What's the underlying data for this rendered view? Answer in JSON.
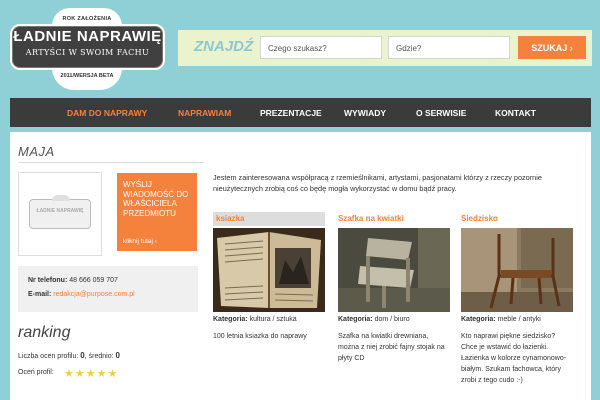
{
  "logo": {
    "top": "ROK ZAŁOŻENIA",
    "title": "ŁADNIE NAPRAWIĘ",
    "subtitle": "ARTYŚCI W SWOIM FACHU",
    "bottom": "2011/WERSJA BETA"
  },
  "search": {
    "label": "ZNAJDŹ",
    "what_placeholder": "Czego szukasz?",
    "where_placeholder": "Gdzie?",
    "button": "SZUKAJ ›"
  },
  "nav": {
    "items": [
      {
        "label": "DAM DO NAPRAWY",
        "active": true
      },
      {
        "label": "NAPRAWIAM",
        "active": true
      },
      {
        "label": "PREZENTACJE",
        "active": false
      },
      {
        "label": "WYWIADY",
        "active": false
      },
      {
        "label": "O SERWISIE",
        "active": false
      },
      {
        "label": "KONTAKT",
        "active": false
      }
    ]
  },
  "profile": {
    "name": "MAJA",
    "avatar_text": "ŁADNIE NAPRAWIĘ",
    "message_box": {
      "text": "WYŚLIJ WIADOMOŚĆ DO WŁAŚCICIELA PRZEDMIOTU",
      "link": "kliknij tutaj ‹"
    },
    "phone_label": "Nr telefonu:",
    "phone": "48 666 059 707",
    "email_label": "E-mail:",
    "email": "redakcja@purpose.com.pl",
    "about": "Jestem zainteresowana współpracą z rzemieślnikami, artystami, pasjonatami którzy z rzeczy pozornie nieużytecznych zrobią coś co będę mogła wykorzystać w domu bądź pracy."
  },
  "ranking": {
    "title": "ranking",
    "count_label": "Liczba ocen profilu:",
    "count": "0",
    "avg_label": ", średnio:",
    "avg": "0",
    "rate_label": "Oceń profil:",
    "stars": 0
  },
  "items": [
    {
      "title": "ksiazka",
      "category_label": "Kategoria:",
      "category": "kultura / sztuka",
      "description": "100 letnia ksiazka do naprawy"
    },
    {
      "title": "Szafka na kwiatki",
      "category_label": "Kategoria:",
      "category": "dom / biuro",
      "description": "Szafka na kwiatki drewniana, można z niej zrobić fajny stojak na płyty CD"
    },
    {
      "title": "Siedzisko",
      "category_label": "Kategoria:",
      "category": "meble / antyki",
      "description": "Kto naprawi piękne siedzisko? Chce je wstawić do łazienki. Łazienka w kolorze cynamonowo-białym. Szukam fachowca, który zrobi z tego cudo :-)"
    }
  ],
  "colors": {
    "background": "#8fcfd6",
    "accent": "#f5823c",
    "nav_bg": "#3b3b3b",
    "search_bg": "#e9f4cf"
  }
}
